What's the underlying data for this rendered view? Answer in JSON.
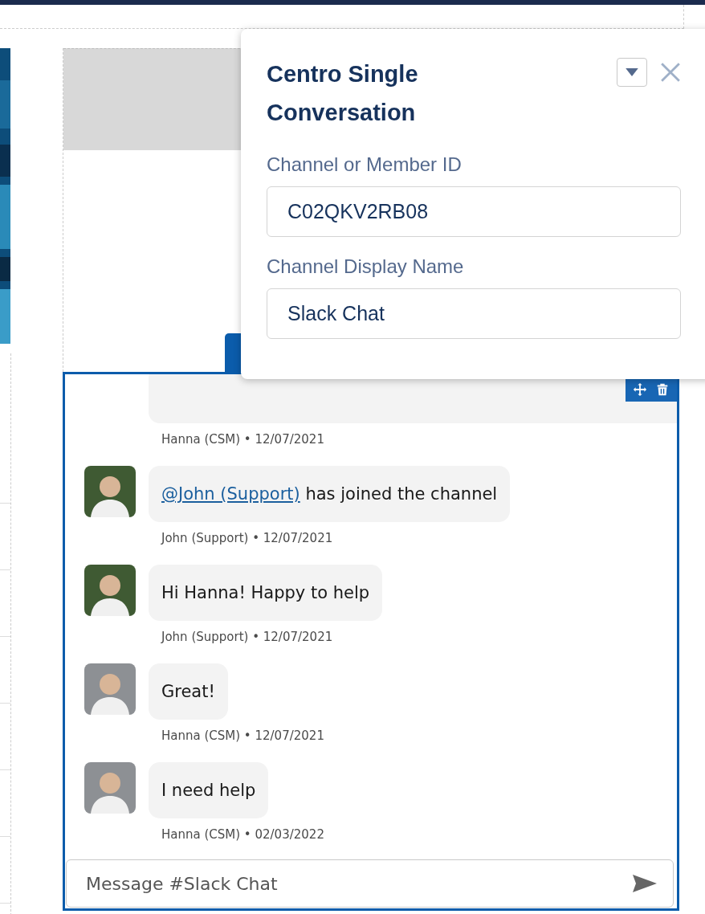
{
  "popover": {
    "title": "Centro Single Conversation",
    "fields": [
      {
        "label": "Channel or Member ID",
        "value": "C02QKV2RB08"
      },
      {
        "label": "Channel Display Name",
        "value": "Slack Chat"
      }
    ]
  },
  "chat": {
    "messages": [
      {
        "meta": "Hanna (CSM) • 12/07/2021"
      },
      {
        "mention": "@John (Support)",
        "text": "has joined the channel",
        "meta": "John (Support) • 12/07/2021",
        "color": "#3f5a33"
      },
      {
        "text": "Hi Hanna! Happy to help",
        "meta": "John (Support) • 12/07/2021",
        "color": "#3f5a33"
      },
      {
        "text": "Great!",
        "meta": "Hanna (CSM) • 12/07/2021",
        "color": "#8d9094"
      },
      {
        "text": "I need help",
        "meta": "Hanna (CSM) • 02/03/2022",
        "color": "#8d9094"
      }
    ],
    "composer": {
      "placeholder": "Message #Slack Chat"
    }
  }
}
